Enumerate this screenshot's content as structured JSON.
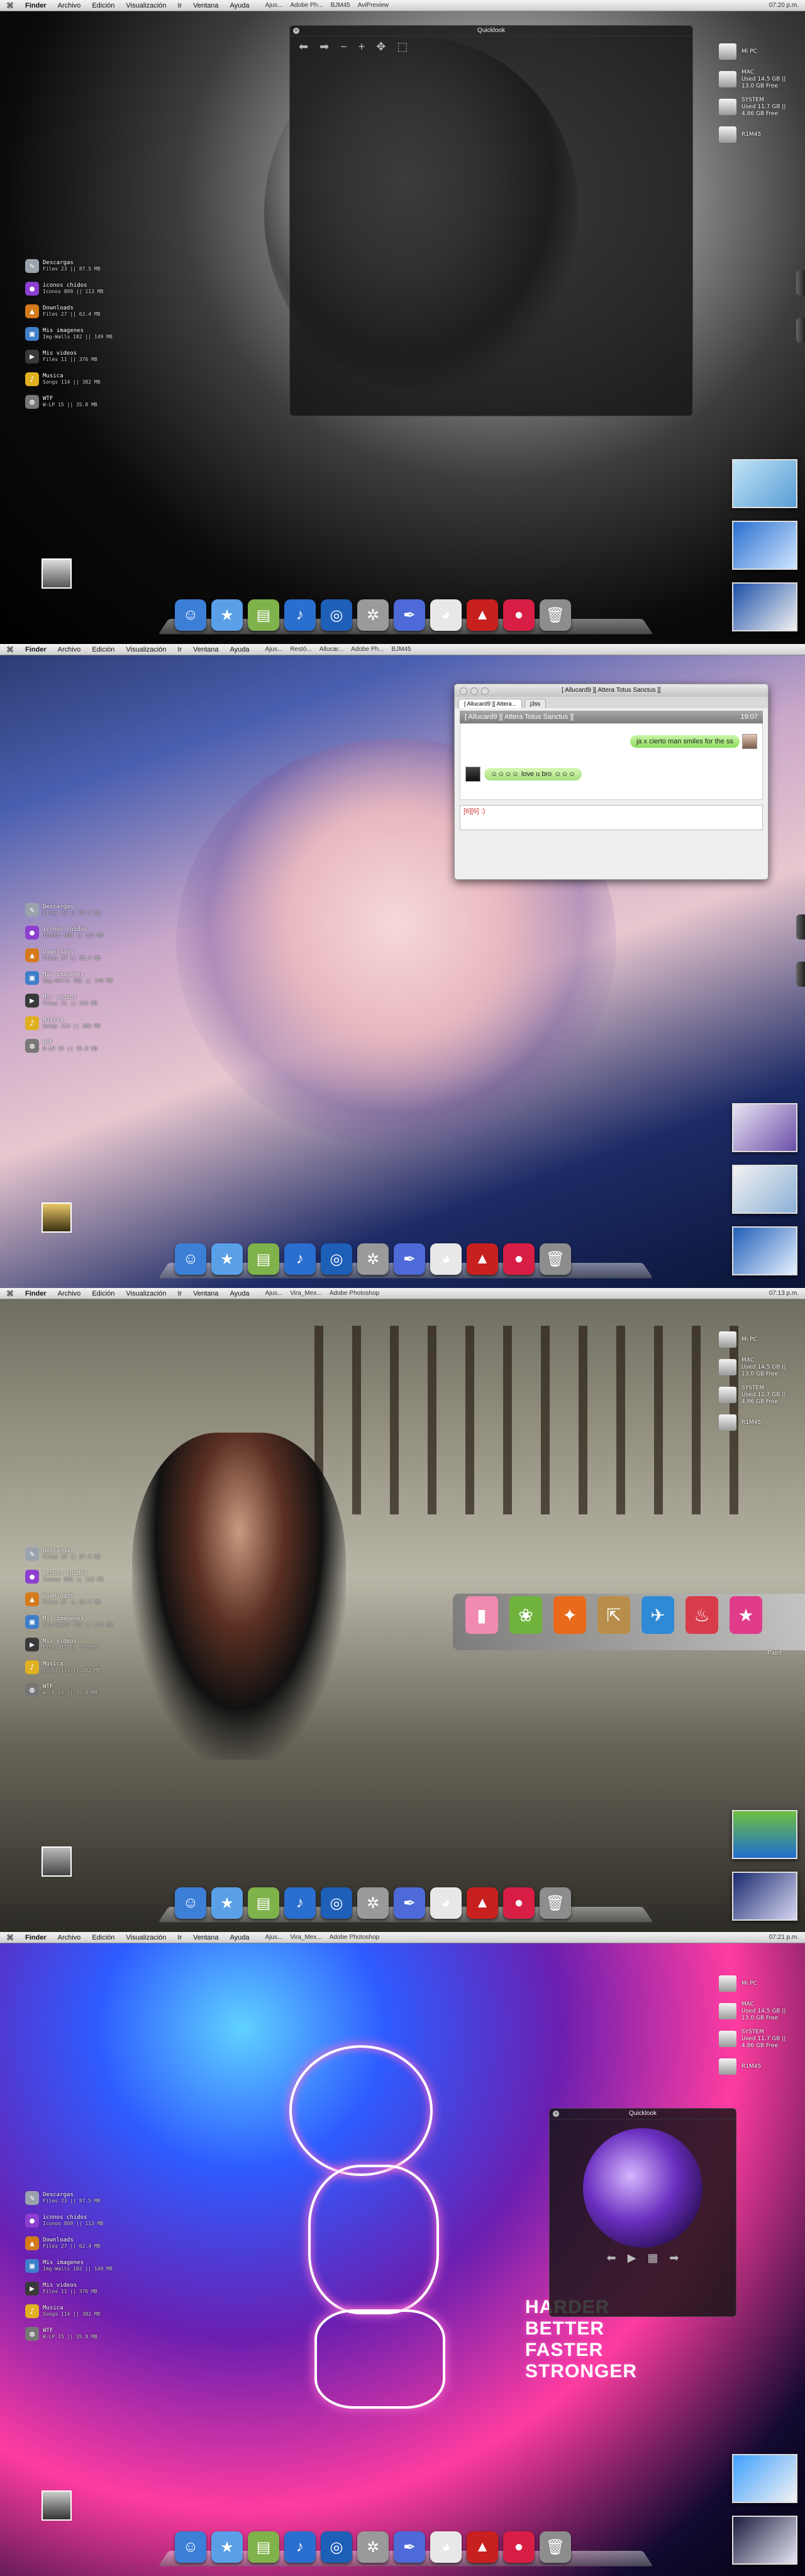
{
  "menubar": {
    "apple": "",
    "items": [
      "Finder",
      "Archivo",
      "Edición",
      "Visualización",
      "Ir",
      "Ventana",
      "Ayuda"
    ],
    "p1_tasks": [
      "Ajus...",
      "Adobe Ph...",
      "BJM45",
      "AviPreview"
    ],
    "p1_clock": "07:20 p.m.",
    "p2_tasks": [
      "Ajus...",
      "Restó...",
      "Allucar...",
      "Adobe Ph...",
      "BJM45"
    ],
    "p3_tasks": [
      "Ajus...",
      "Vira_Mex...",
      "Adobe Photoshop"
    ],
    "p3_clock": "07:13 p.m.",
    "p4_tasks": [
      "Ajus...",
      "Vira_Mex...",
      "Adobe Photoshop"
    ],
    "p4_clock": "07:21 p.m."
  },
  "sidebar": [
    {
      "icon": "apps-icon",
      "title": "Descargas",
      "sub": "Files 23 || 87.5 MB",
      "color": "#9aa3ad"
    },
    {
      "icon": "drop-icon",
      "title": "iconos chidos",
      "sub": "Iconos 809 || 113 MB",
      "color": "#8d3fd0"
    },
    {
      "icon": "boot-icon",
      "title": "Downloads",
      "sub": "Files 27 || 62.4 MB",
      "color": "#d47a1a"
    },
    {
      "icon": "photo-icon",
      "title": "Mis imagenes",
      "sub": "Img-Walls 182 || 149 MB",
      "color": "#3f7fc8"
    },
    {
      "icon": "video-icon",
      "title": "Mis videos",
      "sub": "Files 11 || 376 MB",
      "color": "#3a3a3a"
    },
    {
      "icon": "music-icon",
      "title": "Musica",
      "sub": "Songs 114 || 382 MB",
      "color": "#e0b020"
    },
    {
      "icon": "wtf-icon",
      "title": "WTF",
      "sub": "W-LP 15 || 35.8 MB",
      "color": "#777"
    }
  ],
  "disks": [
    {
      "title": "Mi PC",
      "sub": ""
    },
    {
      "title": "MAC",
      "sub": "Used 14.5 GB || 13.0 GB Free"
    },
    {
      "title": "SYSTEM",
      "sub": "Used 11.7 GB || 4.86 GB Free"
    },
    {
      "title": "R1M45",
      "sub": ""
    }
  ],
  "quicklook1": {
    "title": "Quicklook"
  },
  "quicklook4": {
    "title": "Quicklook"
  },
  "chat": {
    "window_title": "[ Allucard9 ][ Attera Totus Sanctus ][",
    "tab1": "[ Allucard9 ][ Attera...",
    "tab2": "j3ss",
    "header_name": "[ Allucard9 ][ Attera Totus Sanctus ][",
    "header_time": "19:07",
    "msg_me": "ja x cierto man smiles for the ss",
    "msg_them": "love u bro",
    "input_text": "[6][6] :)"
  },
  "stack": {
    "label": "Paint"
  },
  "slogan": [
    "HARDER",
    "BETTER",
    "FASTER",
    "STRONGER"
  ],
  "dock": [
    {
      "icon": "finder-icon",
      "glyph": "☺",
      "color": "#3c7fd6"
    },
    {
      "icon": "star-icon",
      "glyph": "★",
      "color": "#5aa0e8"
    },
    {
      "icon": "preview-icon",
      "glyph": "▤",
      "color": "#7fb24a"
    },
    {
      "icon": "itunes-icon",
      "glyph": "♪",
      "color": "#2a6fcf"
    },
    {
      "icon": "safari-icon",
      "glyph": "◎",
      "color": "#1e5fb8"
    },
    {
      "icon": "system-icon",
      "glyph": "✲",
      "color": "#9a9a9a"
    },
    {
      "icon": "quill-icon",
      "glyph": "✒",
      "color": "#4d6ad8"
    },
    {
      "icon": "adium-icon",
      "glyph": "◕",
      "color": "#e8e8e8"
    },
    {
      "icon": "transmit-icon",
      "glyph": "▲",
      "color": "#c8201e"
    },
    {
      "icon": "photo-booth-icon",
      "glyph": "●",
      "color": "#d81e44"
    },
    {
      "icon": "trash-icon",
      "glyph": "🗑",
      "color": "#8d8d8d"
    }
  ]
}
